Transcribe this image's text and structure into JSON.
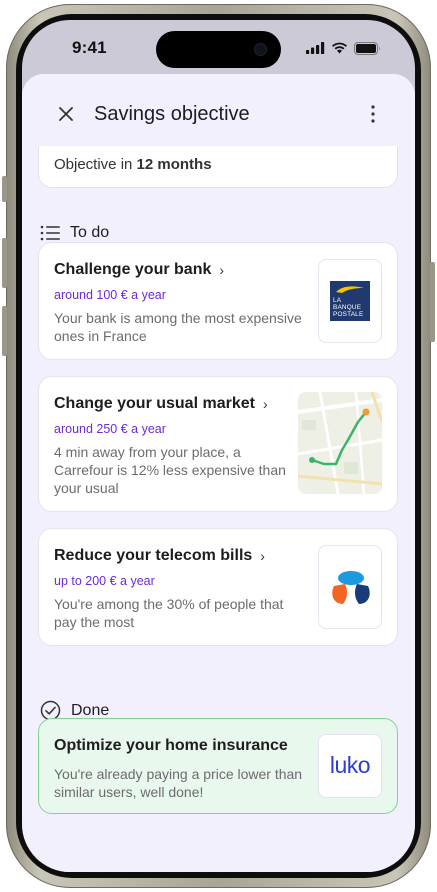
{
  "status_bar": {
    "time": "9:41"
  },
  "header": {
    "title": "Savings objective"
  },
  "previous_card": {
    "prefix": "Objective in",
    "bold": "12 months"
  },
  "todo_section": {
    "label": "To do"
  },
  "done_section": {
    "label": "Done"
  },
  "todo_items": [
    {
      "title": "Challenge your bank",
      "amount": "around 100 € a year",
      "desc_line1": "Your bank is among the most expensive",
      "desc_line2": "ones in France",
      "logo": {
        "name": "la-banque-postale-logo",
        "line1": "LA",
        "line2": "BANQUE",
        "line3": "POSTALE",
        "color": "#20396e"
      }
    },
    {
      "title": "Change your usual market",
      "amount": "around 250 € a year",
      "desc_line1": "4 min away from your place, a",
      "desc_line2": "Carrefour is 12% less expensive than",
      "desc_line3": "your usual",
      "image": "map-route-thumbnail"
    },
    {
      "title": "Reduce your telecom bills",
      "amount": "up to 200 € a year",
      "desc_line1": "You're among the 30% of people that",
      "desc_line2": "pay the most",
      "logo": {
        "name": "bouygues-telecom-logo"
      }
    }
  ],
  "done_items": [
    {
      "title": "Optimize your home insurance",
      "desc_line1": "You're already paying a price lower than",
      "desc_line2": "similar users, well done!",
      "logo": {
        "name": "luko-logo",
        "text": "luko",
        "color": "#2b3ecf"
      }
    }
  ],
  "colors": {
    "accent": "#6c2bd9",
    "sheet_bg": "#f3f0fd",
    "done_bg": "#e8f8ec",
    "done_border": "#7fd396"
  }
}
